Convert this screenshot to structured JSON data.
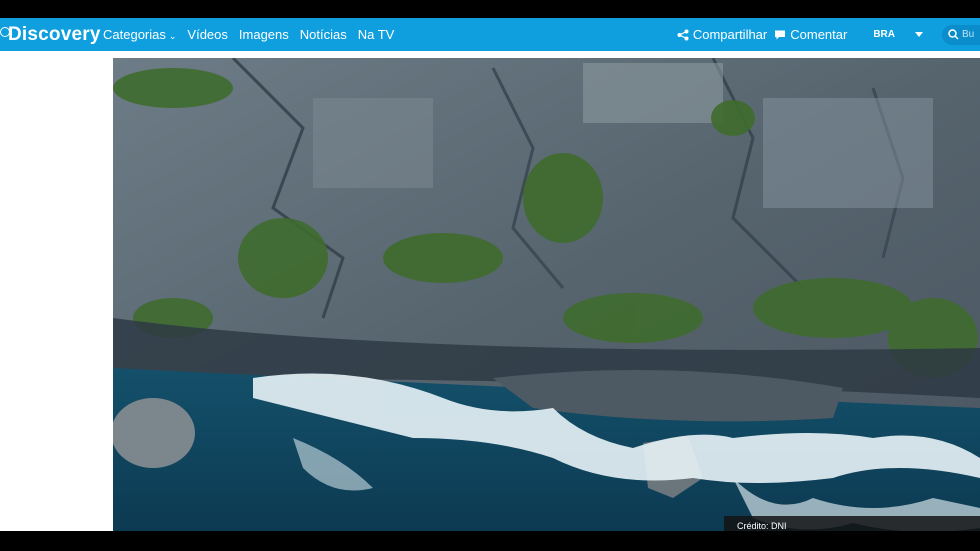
{
  "brand": {
    "name": "Discovery",
    "color": "#0f9fdf"
  },
  "nav": {
    "items": [
      {
        "label": "Categorias",
        "has_dropdown": true
      },
      {
        "label": "Vídeos"
      },
      {
        "label": "Imagens"
      },
      {
        "label": "Notícias"
      },
      {
        "label": "Na TV"
      }
    ]
  },
  "actions": {
    "share_label": "Compartilhar",
    "comment_label": "Comentar"
  },
  "region": {
    "code": "BRA"
  },
  "search": {
    "placeholder": "Bu"
  },
  "photo": {
    "credit": "Crédito: DNI"
  }
}
